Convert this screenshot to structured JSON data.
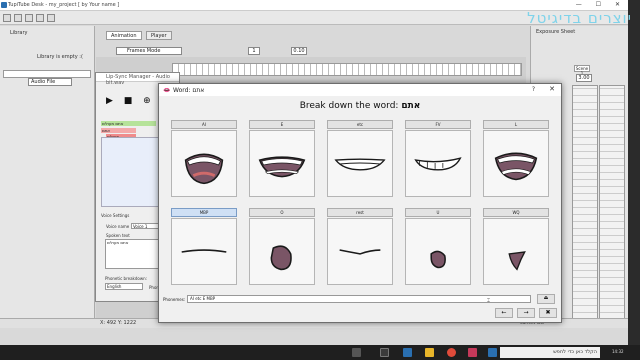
{
  "app": {
    "title": "TupiTube Desk - my_project [ by Your name ]",
    "window_buttons": "— ☐ ✕"
  },
  "library": {
    "header": "Library",
    "empty_text": "Library is empty :(",
    "type_select": "Audio File"
  },
  "center": {
    "tabs": [
      {
        "label": "Animation"
      },
      {
        "label": "Player"
      }
    ],
    "frames_mode": "Frames Mode",
    "frame_field": "1",
    "fps_field": "0.10"
  },
  "exposure": {
    "title": "Exposure Sheet",
    "scene": "Scene 1",
    "fps": "3.00"
  },
  "watermark": "יוצרים בדיגיטל",
  "status": {
    "coords": "X: 492 Y: 1222",
    "current_tool": "Current Tool"
  },
  "lipsync": {
    "title": "Lip-Sync Manager - Audio bit.wav",
    "controls": "▶ ■ ⊕ ⊖",
    "tracks": [
      "אתם מעולים",
      "אתם",
      "מעולים"
    ],
    "voice_settings": "Voice Settings",
    "voice_name_label": "Voice name",
    "voice_name_value": "Voice 1",
    "spoken_text_label": "Spoken text",
    "spoken_text_value": "אתם מעולים",
    "phonetic_label": "Phonetic breakdown:",
    "language": "English",
    "phoneme_tab": "Phone"
  },
  "word_dialog": {
    "title": "Word: אתם",
    "help": "?",
    "close": "✕",
    "heading_prefix": "Break down the word:",
    "heading_word": "אתם",
    "phonemes": [
      {
        "label": "AI",
        "selected": false
      },
      {
        "label": "E",
        "selected": false
      },
      {
        "label": "etc",
        "selected": false
      },
      {
        "label": "FV",
        "selected": false
      },
      {
        "label": "L",
        "selected": false
      },
      {
        "label": "MBP",
        "selected": true
      },
      {
        "label": "O",
        "selected": false
      },
      {
        "label": "rest",
        "selected": false
      },
      {
        "label": "U",
        "selected": false
      },
      {
        "label": "WQ",
        "selected": false
      }
    ],
    "phonemes_label": "Phonemes:",
    "phonemes_value": "AI etc E MBP",
    "nav_prev": "←",
    "nav_next": "→",
    "nav_close": "✖"
  },
  "taskbar": {
    "search_placeholder": "הקלד כאן כדי לחפש",
    "time": "14:32"
  },
  "colors": {
    "mouth_fill": "#7a5566",
    "mouth_stroke": "#1a1a1a",
    "teeth": "#ffffff",
    "selected_phoneme": "#cfe0f5",
    "watermark": "#7fd3ea"
  }
}
